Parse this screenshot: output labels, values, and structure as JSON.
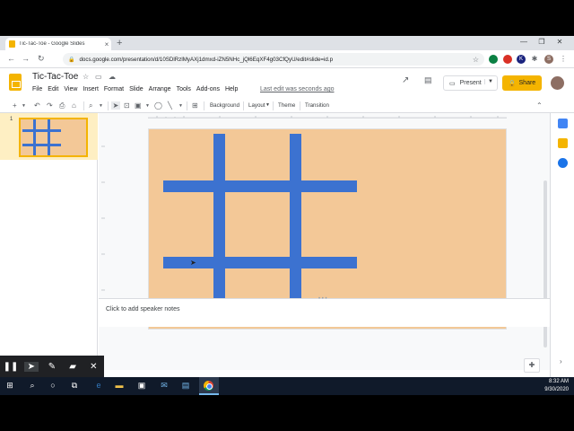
{
  "browser": {
    "tab_title": "Tic-Tac-Toe - Google Slides",
    "new_tab": "+",
    "close_tab": "×",
    "url": "docs.google.com/presentation/d/10SDlRzlMyAXj1dmxd-iZN5NHc_jQl6EqXF4g03CfQyU/edit#slide=id.p",
    "extension_initials": [
      "K",
      "S"
    ]
  },
  "docs": {
    "title": "Tic-Tac-Toe",
    "menu": [
      "File",
      "Edit",
      "View",
      "Insert",
      "Format",
      "Slide",
      "Arrange",
      "Tools",
      "Add-ons",
      "Help"
    ],
    "last_edit": "Last edit was seconds ago",
    "present_label": "Present",
    "share_label": "Share"
  },
  "toolbar": {
    "background": "Background",
    "layout": "Layout",
    "theme": "Theme",
    "transition": "Transition"
  },
  "filmstrip": {
    "slide_number": "1"
  },
  "notes": {
    "placeholder": "Click to add speaker notes"
  },
  "clock": {
    "time": "8:32 AM",
    "date": "9/30/2020"
  },
  "colors": {
    "slide_bg": "#f3c897",
    "grid_bar": "#3c72d0",
    "accent": "#f4b400"
  }
}
